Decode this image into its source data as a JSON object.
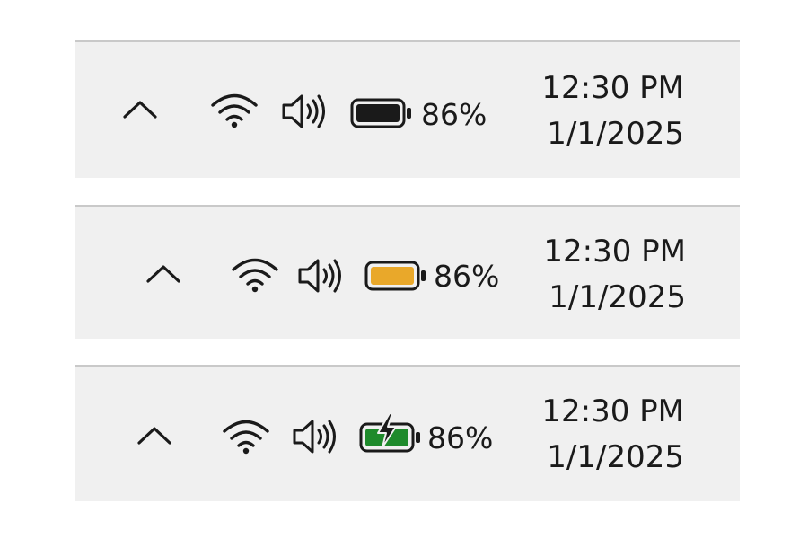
{
  "trays": [
    {
      "battery_state": "normal",
      "battery_fill_color": "#1a1a1a",
      "battery_percent": "86%",
      "time": "12:30 PM",
      "date": "1/1/2025"
    },
    {
      "battery_state": "saver",
      "battery_fill_color": "#e9a82a",
      "battery_percent": "86%",
      "time": "12:30 PM",
      "date": "1/1/2025"
    },
    {
      "battery_state": "charging",
      "battery_fill_color": "#1e8a2b",
      "battery_percent": "86%",
      "time": "12:30 PM",
      "date": "1/1/2025"
    }
  ],
  "icons": {
    "overflow": "chevron-up-icon",
    "network": "wifi-icon",
    "volume": "speaker-icon",
    "battery": "battery-icon",
    "charging": "lightning-bolt-icon"
  }
}
